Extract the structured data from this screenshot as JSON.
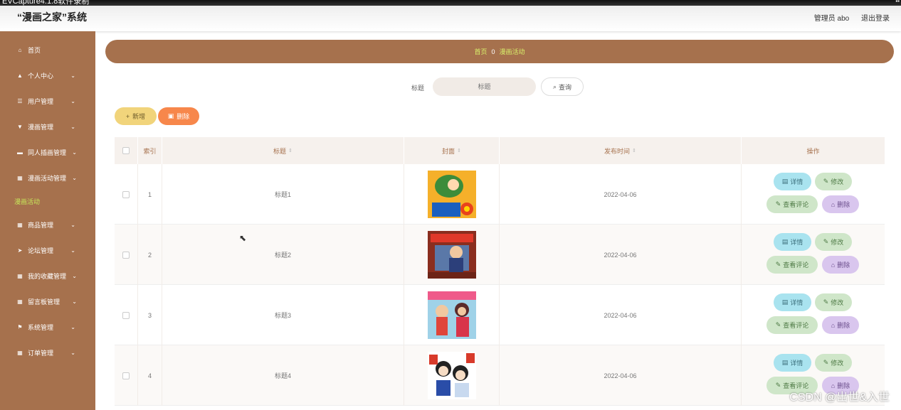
{
  "recorder": {
    "title": "EVCapture4.1.8软件录制"
  },
  "header": {
    "title": "“漫画之家”系统",
    "user": "管理员 abo",
    "logout": "退出登录"
  },
  "sidebar": {
    "items": [
      {
        "label": "首页",
        "icon": "home-icon",
        "glyph": "⌂",
        "chevron": false
      },
      {
        "label": "个人中心",
        "icon": "user-icon",
        "glyph": "▲",
        "chevron": true
      },
      {
        "label": "用户管理",
        "icon": "list-icon",
        "glyph": "☰",
        "chevron": true
      },
      {
        "label": "漫画管理",
        "icon": "book-icon",
        "glyph": "▼",
        "chevron": true
      },
      {
        "label": "同人插画管理",
        "icon": "folder-icon",
        "glyph": "▬",
        "chevron": true
      },
      {
        "label": "漫画活动管理",
        "icon": "grid-icon",
        "glyph": "▦",
        "chevron": true
      },
      {
        "label": "商品管理",
        "icon": "grid-icon",
        "glyph": "▦",
        "chevron": true
      },
      {
        "label": "论坛管理",
        "icon": "send-icon",
        "glyph": "➤",
        "chevron": true
      },
      {
        "label": "我的收藏管理",
        "icon": "grid-icon",
        "glyph": "▦",
        "chevron": true
      },
      {
        "label": "留言板管理",
        "icon": "grid-icon",
        "glyph": "▦",
        "chevron": true
      },
      {
        "label": "系统管理",
        "icon": "flag-icon",
        "glyph": "⚑",
        "chevron": true
      },
      {
        "label": "订单管理",
        "icon": "grid-icon",
        "glyph": "▦",
        "chevron": true
      }
    ],
    "active_sub": "漫画活动"
  },
  "breadcrumb": {
    "home": "首页",
    "sep": "0",
    "current": "漫画活动"
  },
  "search": {
    "label": "标题",
    "placeholder": "标题",
    "button": "查询"
  },
  "actions": {
    "add": "新增",
    "delete": "删除"
  },
  "table": {
    "headers": {
      "index": "索引",
      "title": "标题",
      "cover": "封面",
      "time": "发布时间",
      "ops": "操作"
    },
    "rows": [
      {
        "index": "1",
        "title": "标题1",
        "time": "2022-04-06"
      },
      {
        "index": "2",
        "title": "标题2",
        "time": "2022-04-06"
      },
      {
        "index": "3",
        "title": "标题3",
        "time": "2022-04-06"
      },
      {
        "index": "4",
        "title": "标题4",
        "time": "2022-04-06"
      }
    ],
    "ops": {
      "detail": "详情",
      "edit": "修改",
      "comment": "查看评论",
      "delete": "删除"
    }
  },
  "watermark": "CSDN @出世&入世",
  "colors": {
    "accent": "#a6714d",
    "breadcrumb_text": "#d8f06a",
    "add": "#f1d47b",
    "delete": "#f7874b"
  }
}
